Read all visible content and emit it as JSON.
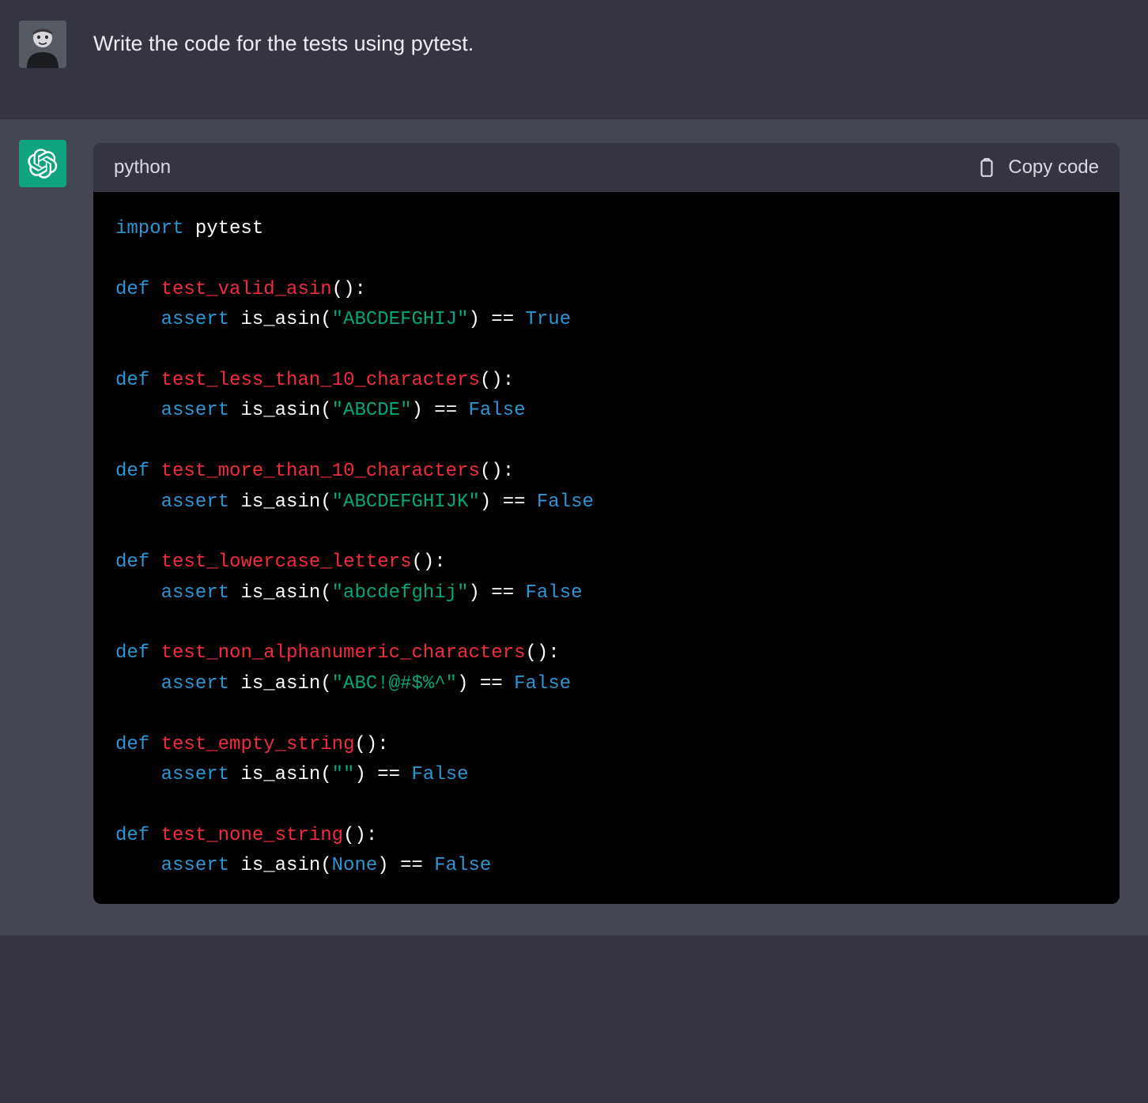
{
  "user_message": "Write the code for the tests using pytest.",
  "code_block": {
    "language_label": "python",
    "copy_label": "Copy code",
    "tokens": [
      [
        [
          "kw",
          "import"
        ],
        [
          "id",
          " pytest"
        ]
      ],
      [],
      [
        [
          "kw",
          "def"
        ],
        [
          "id",
          " "
        ],
        [
          "fn",
          "test_valid_asin"
        ],
        [
          "pun",
          "():"
        ]
      ],
      [
        [
          "id",
          "    "
        ],
        [
          "kw",
          "assert"
        ],
        [
          "id",
          " is_asin("
        ],
        [
          "str",
          "\"ABCDEFGHIJ\""
        ],
        [
          "id",
          ") == "
        ],
        [
          "bool",
          "True"
        ]
      ],
      [],
      [
        [
          "kw",
          "def"
        ],
        [
          "id",
          " "
        ],
        [
          "fn",
          "test_less_than_10_characters"
        ],
        [
          "pun",
          "():"
        ]
      ],
      [
        [
          "id",
          "    "
        ],
        [
          "kw",
          "assert"
        ],
        [
          "id",
          " is_asin("
        ],
        [
          "str",
          "\"ABCDE\""
        ],
        [
          "id",
          ") == "
        ],
        [
          "bool",
          "False"
        ]
      ],
      [],
      [
        [
          "kw",
          "def"
        ],
        [
          "id",
          " "
        ],
        [
          "fn",
          "test_more_than_10_characters"
        ],
        [
          "pun",
          "():"
        ]
      ],
      [
        [
          "id",
          "    "
        ],
        [
          "kw",
          "assert"
        ],
        [
          "id",
          " is_asin("
        ],
        [
          "str",
          "\"ABCDEFGHIJK\""
        ],
        [
          "id",
          ") == "
        ],
        [
          "bool",
          "False"
        ]
      ],
      [],
      [
        [
          "kw",
          "def"
        ],
        [
          "id",
          " "
        ],
        [
          "fn",
          "test_lowercase_letters"
        ],
        [
          "pun",
          "():"
        ]
      ],
      [
        [
          "id",
          "    "
        ],
        [
          "kw",
          "assert"
        ],
        [
          "id",
          " is_asin("
        ],
        [
          "str",
          "\"abcdefghij\""
        ],
        [
          "id",
          ") == "
        ],
        [
          "bool",
          "False"
        ]
      ],
      [],
      [
        [
          "kw",
          "def"
        ],
        [
          "id",
          " "
        ],
        [
          "fn",
          "test_non_alphanumeric_characters"
        ],
        [
          "pun",
          "():"
        ]
      ],
      [
        [
          "id",
          "    "
        ],
        [
          "kw",
          "assert"
        ],
        [
          "id",
          " is_asin("
        ],
        [
          "str",
          "\"ABC!@#$%^\""
        ],
        [
          "id",
          ") == "
        ],
        [
          "bool",
          "False"
        ]
      ],
      [],
      [
        [
          "kw",
          "def"
        ],
        [
          "id",
          " "
        ],
        [
          "fn",
          "test_empty_string"
        ],
        [
          "pun",
          "():"
        ]
      ],
      [
        [
          "id",
          "    "
        ],
        [
          "kw",
          "assert"
        ],
        [
          "id",
          " is_asin("
        ],
        [
          "str",
          "\"\""
        ],
        [
          "id",
          ") == "
        ],
        [
          "bool",
          "False"
        ]
      ],
      [],
      [
        [
          "kw",
          "def"
        ],
        [
          "id",
          " "
        ],
        [
          "fn",
          "test_none_string"
        ],
        [
          "pun",
          "():"
        ]
      ],
      [
        [
          "id",
          "    "
        ],
        [
          "kw",
          "assert"
        ],
        [
          "id",
          " is_asin("
        ],
        [
          "bool",
          "None"
        ],
        [
          "id",
          ") == "
        ],
        [
          "bool",
          "False"
        ]
      ]
    ]
  }
}
